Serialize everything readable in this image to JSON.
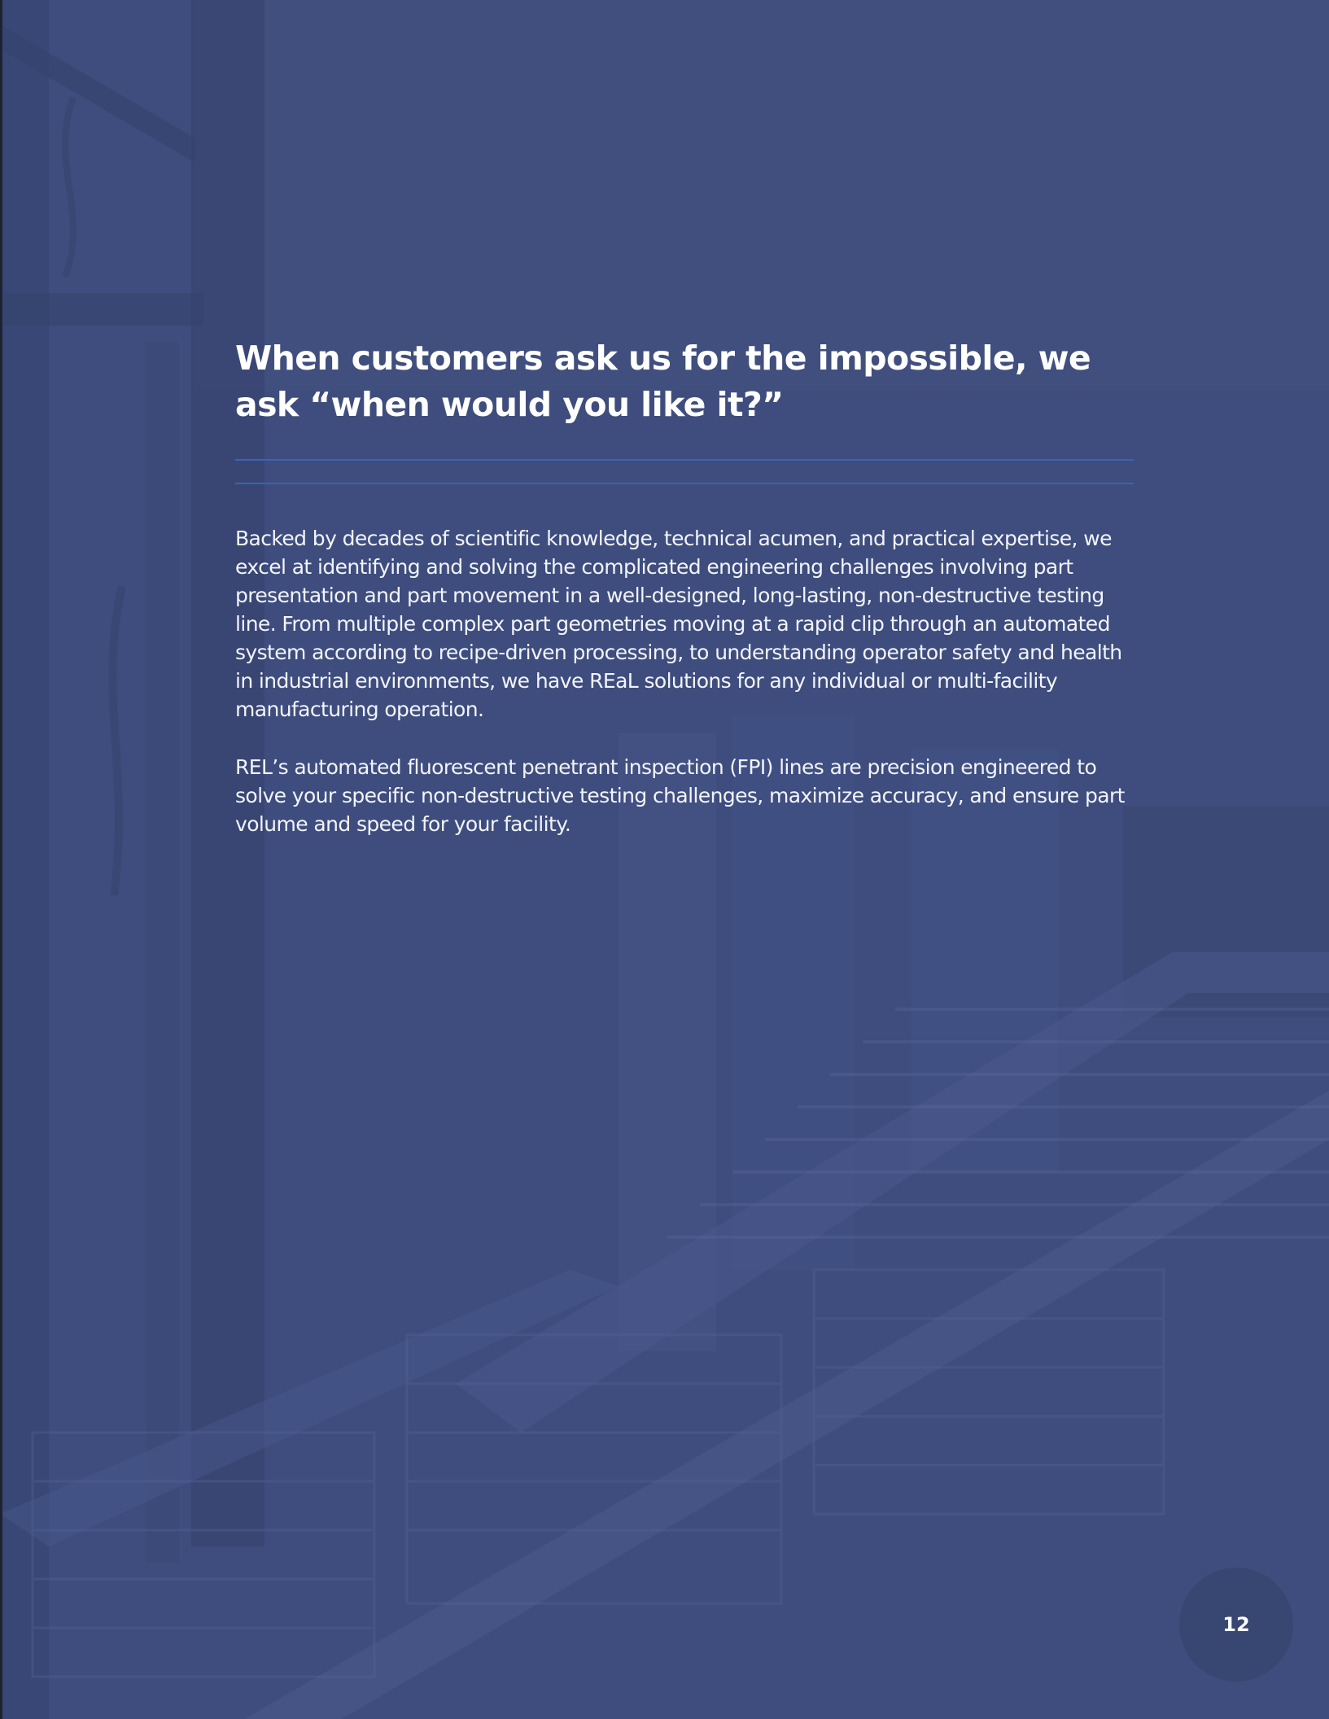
{
  "headline": "When customers ask us for the impossible, we ask “when would you like it?”",
  "paragraphs": [
    "Backed by decades of scientific knowledge, technical acumen, and practical expertise, we excel at identifying and solving the complicated engineering challenges involving part presentation and part movement in a well-designed, long-lasting, non-destructive testing line. From multiple complex part geometries moving at a rapid clip through an automated system according to recipe-driven processing, to understanding operator safety and health in industrial environments, we have REaL solutions for any individual or multi-facility manufacturing operation.",
    "REL’s automated fluorescent penetrant inspection (FPI) lines are precision engineered to solve your specific non-destructive testing challenges, maximize accuracy, and ensure part volume and speed for your facility."
  ],
  "page_number": "12",
  "colors": {
    "overlay": "#3e4d7d",
    "rule": "#3565b8",
    "text": "#ffffff"
  }
}
